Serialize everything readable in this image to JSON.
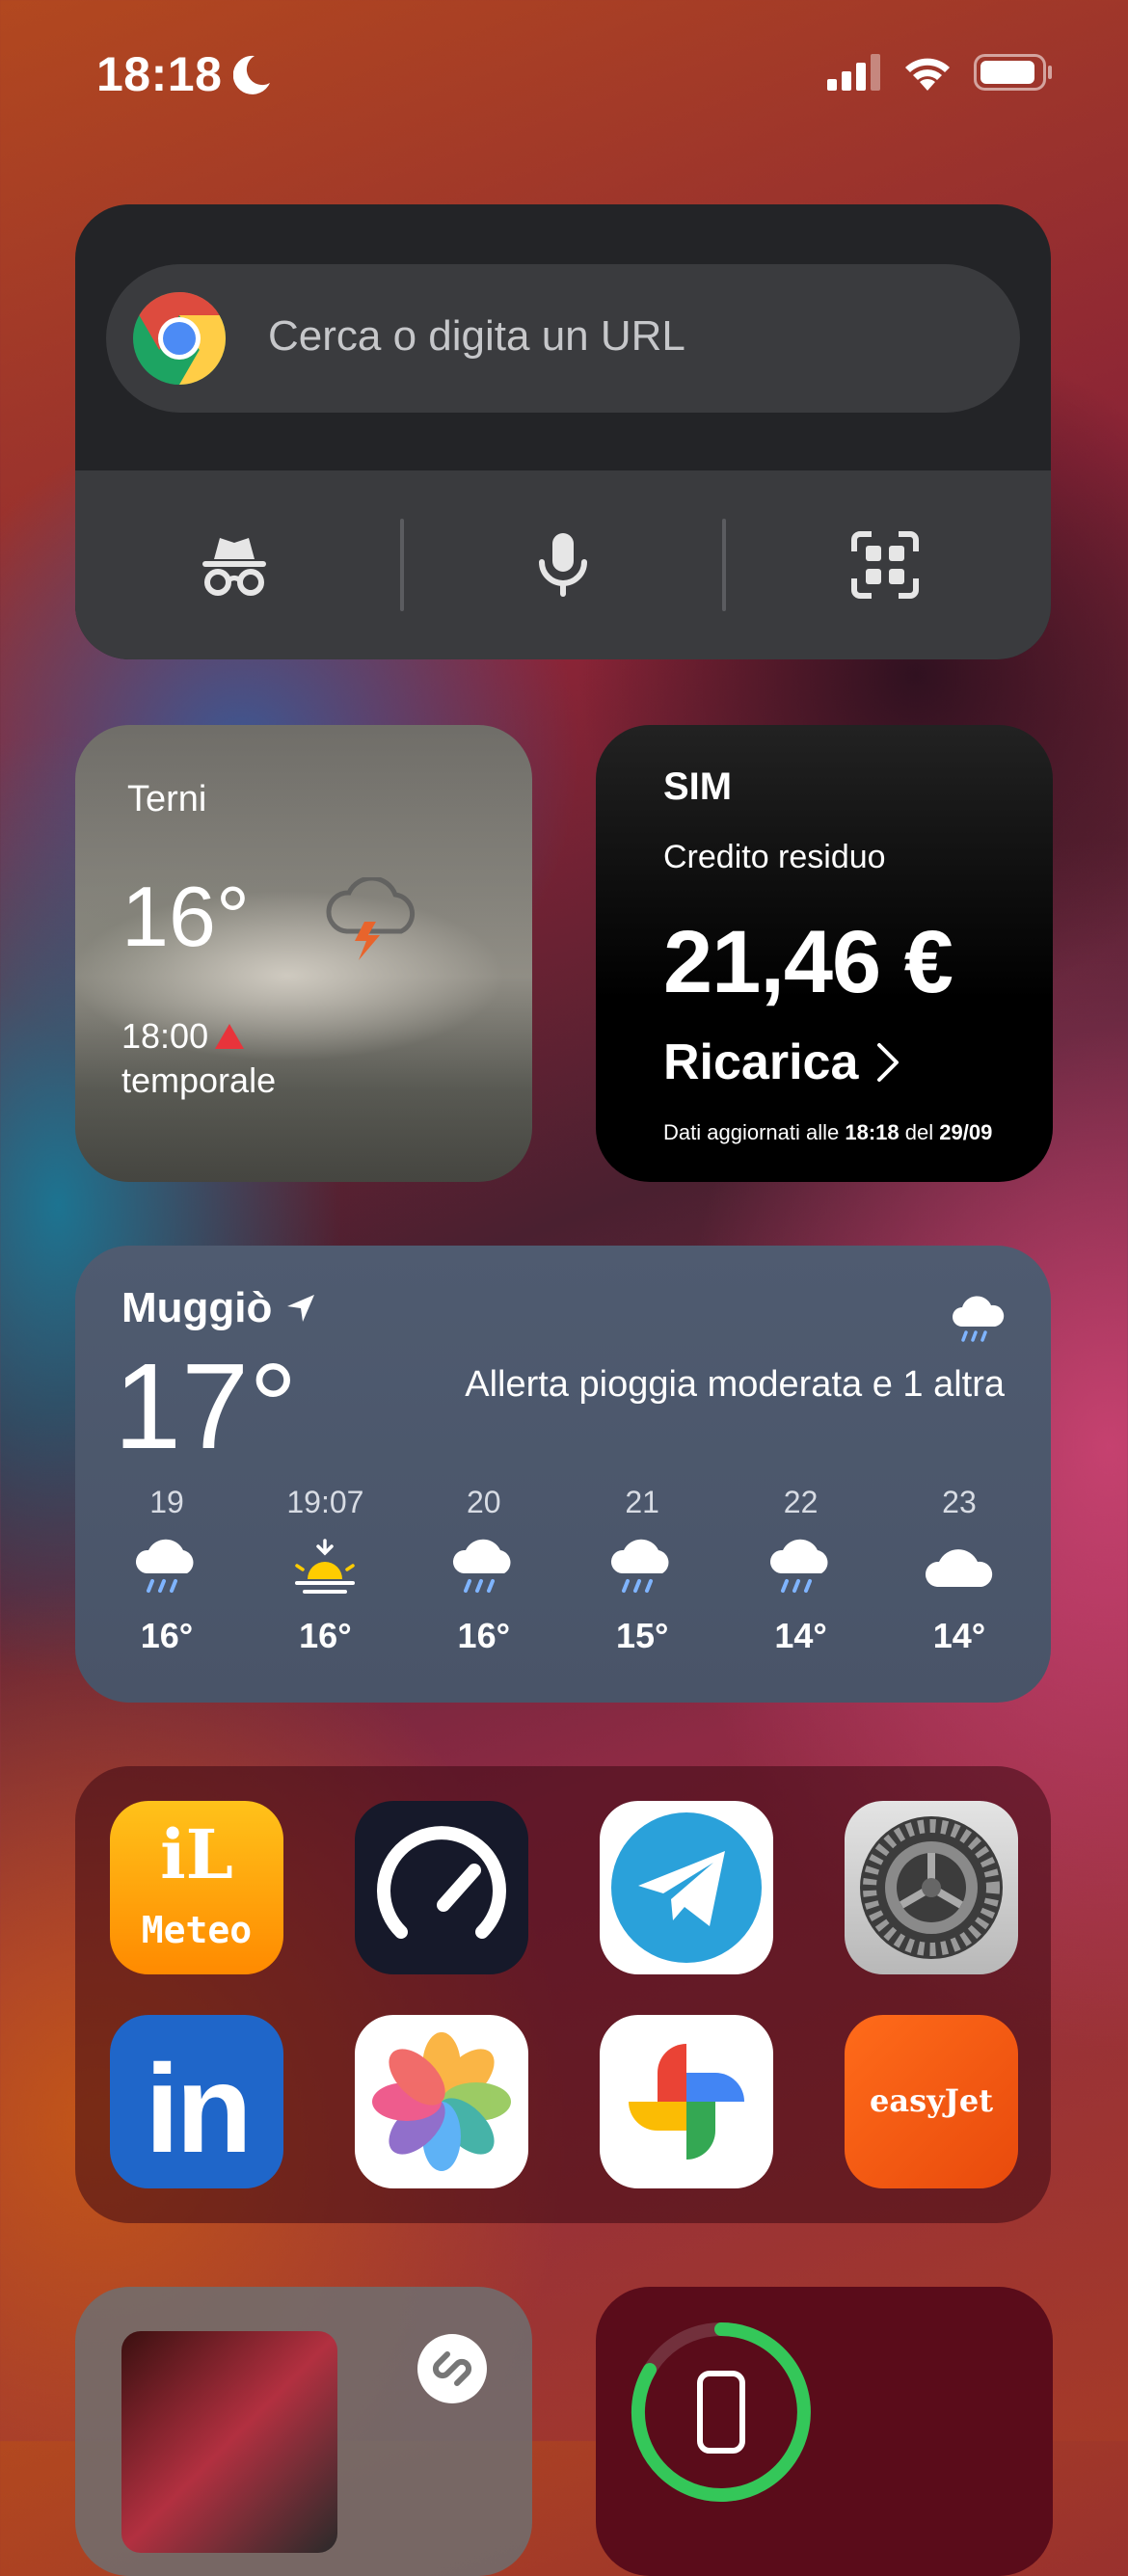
{
  "status_bar": {
    "time": "18:18",
    "focus_icon": "moon-icon",
    "icons": [
      "cellular-signal-icon",
      "wifi-icon",
      "battery-icon"
    ]
  },
  "chrome_widget": {
    "search_placeholder": "Cerca o digita un URL",
    "buttons": [
      "incognito-icon",
      "microphone-icon",
      "qr-scan-icon"
    ]
  },
  "weather_small": {
    "city": "Terni",
    "temperature": "16°",
    "time": "18:00",
    "condition": "temporale",
    "icon": "thunderstorm-cloud-icon"
  },
  "sim_widget": {
    "title": "SIM",
    "label": "Credito residuo",
    "amount": "21,46 €",
    "action": "Ricarica",
    "footer_prefix": "Dati aggiornati alle",
    "footer_time": "18:18",
    "footer_mid": "del",
    "footer_date": "29/09"
  },
  "weather_large": {
    "city": "Muggiò",
    "temperature": "17°",
    "alert": "Allerta pioggia moderata e 1 altra",
    "icon": "rain-cloud-icon",
    "hours": [
      {
        "label": "19",
        "icon": "rain",
        "temp": "16°"
      },
      {
        "label": "19:07",
        "icon": "sunset",
        "temp": "16°"
      },
      {
        "label": "20",
        "icon": "rain",
        "temp": "16°"
      },
      {
        "label": "21",
        "icon": "rain",
        "temp": "15°"
      },
      {
        "label": "22",
        "icon": "rain",
        "temp": "14°"
      },
      {
        "label": "23",
        "icon": "cloud",
        "temp": "14°"
      }
    ]
  },
  "apps": {
    "ilmeteo_line1": "iL",
    "ilmeteo_line2": "Meteo",
    "easyjet": "easyJet",
    "linkedin": "in",
    "names": [
      "iLMeteo",
      "Speedtest",
      "Telegram",
      "Settings",
      "LinkedIn",
      "Photos",
      "Google Photos",
      "easyJet"
    ]
  },
  "colors": {
    "chrome_widget_bg": "#232427",
    "weather_large_bg": "#4f5b70",
    "sim_bg": "#000000",
    "warning": "#e8343b",
    "battery_ring": "#34c759"
  }
}
